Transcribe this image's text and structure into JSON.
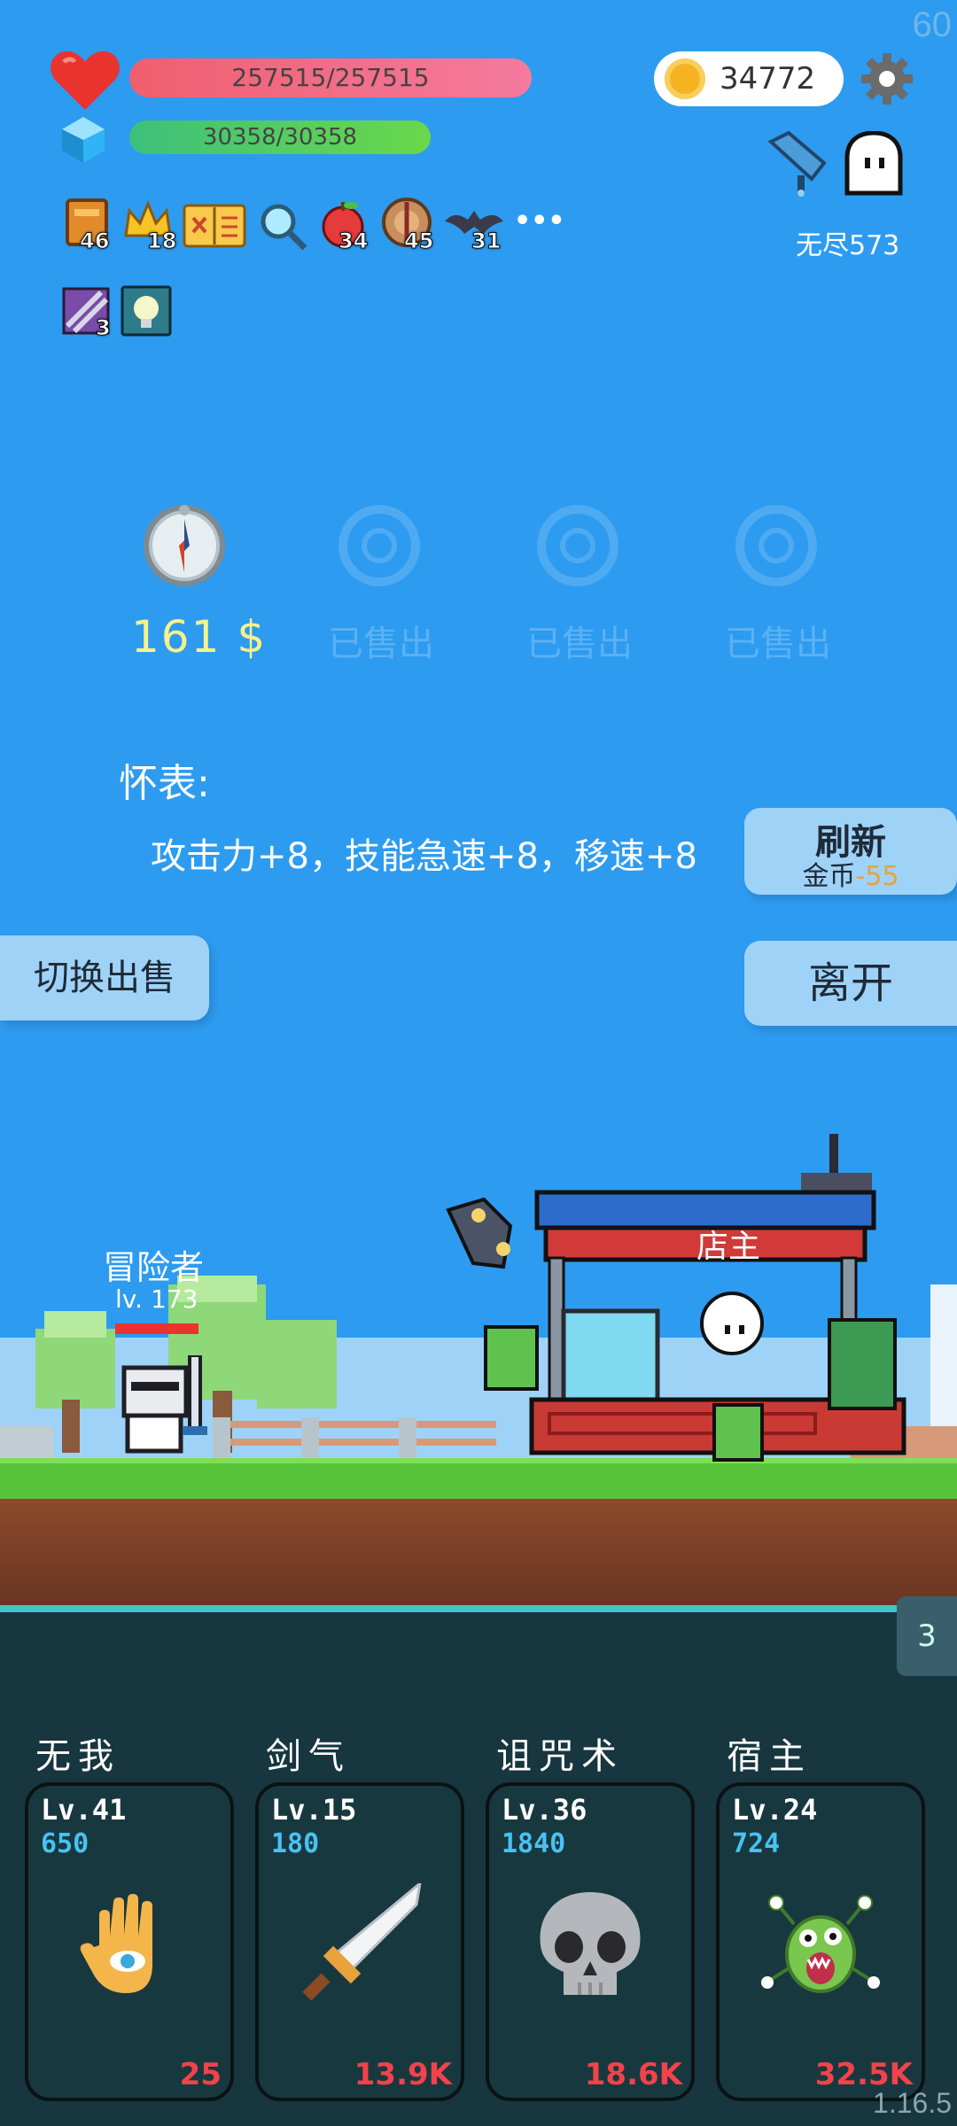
{
  "fps": "60",
  "hud": {
    "hp": "257515/257515",
    "mp": "30358/30358",
    "coins": "34772",
    "endless_label": "无尽573",
    "buffs_row1": [
      {
        "icon": "book-icon",
        "count": "46"
      },
      {
        "icon": "crown-icon",
        "count": "18"
      },
      {
        "icon": "map-icon",
        "count": ""
      },
      {
        "icon": "magnifier-icon",
        "count": ""
      },
      {
        "icon": "apple-icon",
        "count": "34"
      },
      {
        "icon": "shield-icon",
        "count": "45"
      },
      {
        "icon": "bat-icon",
        "count": "31"
      }
    ],
    "more": "•••",
    "buffs_row2": [
      {
        "icon": "scroll-icon",
        "count": "3"
      },
      {
        "icon": "lightbulb-icon",
        "count": ""
      }
    ]
  },
  "shop": {
    "items": [
      {
        "icon": "compass-icon",
        "label": "161 $",
        "sold": false
      },
      {
        "icon": "crown-badge-icon",
        "label": "已售出",
        "sold": true
      },
      {
        "icon": "crown-badge-icon",
        "label": "已售出",
        "sold": true
      },
      {
        "icon": "crown-badge-icon",
        "label": "已售出",
        "sold": true
      }
    ],
    "selected_name": "怀表:",
    "selected_desc": "攻击力+8，技能急速+8，移速+8",
    "refresh_title": "刷新",
    "refresh_cost_label": "金币",
    "refresh_cost": "-55",
    "switch_label": "切换出售",
    "leave_label": "离开"
  },
  "scene": {
    "adventurer_label": "冒险者",
    "adventurer_level": "lv. 173",
    "shopkeeper_label": "店主",
    "wave": "3"
  },
  "skills": [
    {
      "name": "无我",
      "level": "Lv.41",
      "power": "650",
      "cost": "25",
      "icon": "eye-hand-icon"
    },
    {
      "name": "剑气",
      "level": "Lv.15",
      "power": "180",
      "cost": "13.9K",
      "icon": "sword-icon"
    },
    {
      "name": "诅咒术",
      "level": "Lv.36",
      "power": "1840",
      "cost": "18.6K",
      "icon": "skull-icon"
    },
    {
      "name": "宿主",
      "level": "Lv.24",
      "power": "724",
      "cost": "32.5K",
      "icon": "eyeball-monster-icon"
    }
  ],
  "version": "1.16.5",
  "colors": {
    "sky": "#2D9BF0",
    "hp_bar": "#F05F6E",
    "mp_bar": "#3DC07C",
    "price": "#F8F28C",
    "skill_cost": "#F2424A",
    "skill_power": "#48C2F0"
  }
}
